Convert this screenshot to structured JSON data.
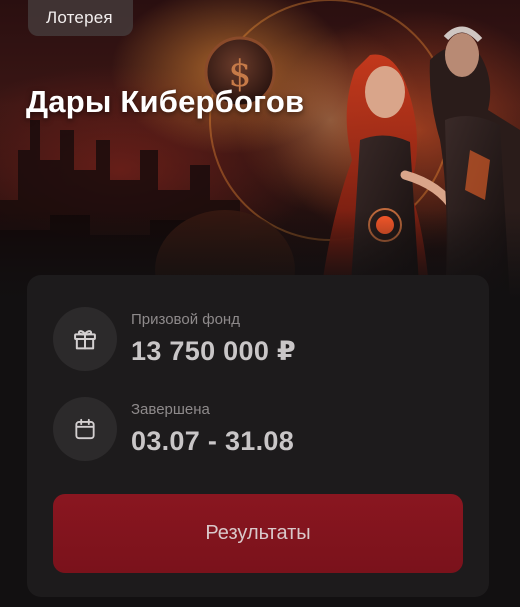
{
  "hero": {
    "badge": "Лотерея",
    "title": "Дары Кибербогов"
  },
  "info": {
    "prize_label": "Призовой фонд",
    "prize_value": "13 750 000 ₽",
    "status_label": "Завершена",
    "dates_value": "03.07 - 31.08"
  },
  "actions": {
    "results_label": "Результаты"
  },
  "colors": {
    "accent": "#8a1620",
    "panel": "#1d1b1c",
    "background": "#121011"
  }
}
